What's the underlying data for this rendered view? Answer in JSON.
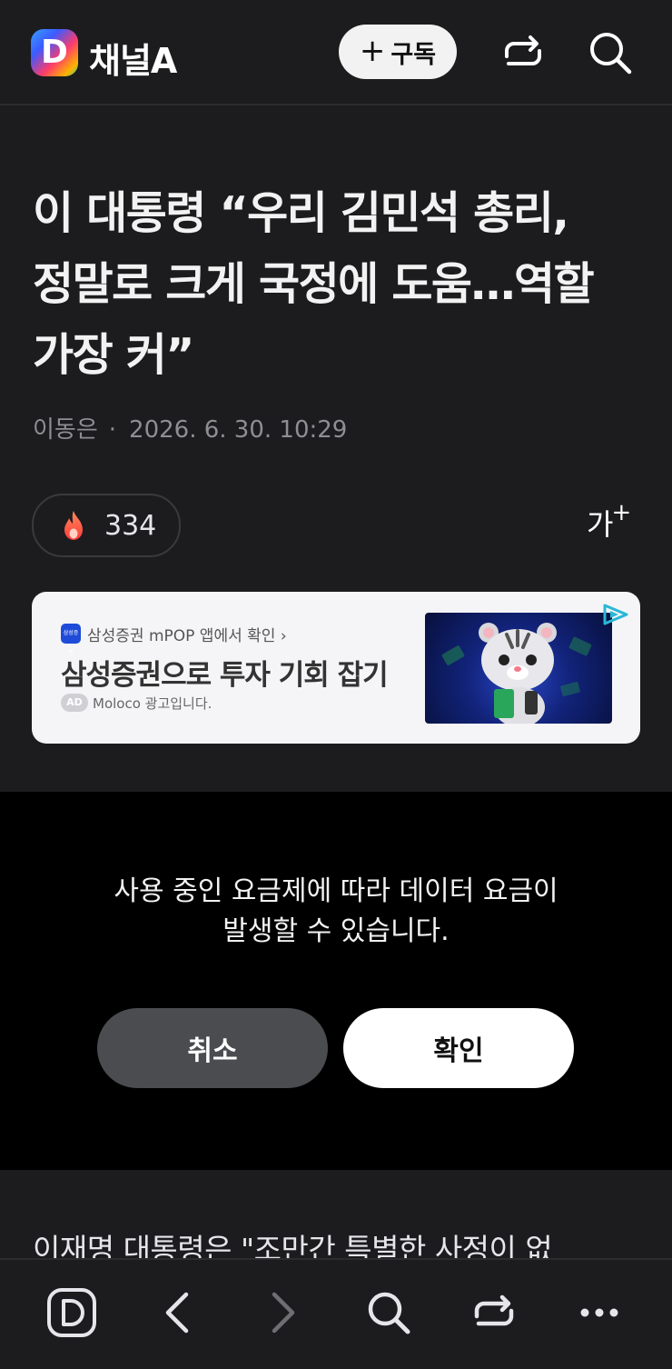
{
  "header": {
    "logo_letter": "D",
    "brand": "채널A",
    "subscribe_plus": "+",
    "subscribe_label": "구독"
  },
  "article": {
    "headline_lines": [
      "이 대통령 “우리 김민석 총리,",
      "정말로 크게 국정에 도움…역할",
      "가장 커”"
    ],
    "author": "이동은",
    "separator": "·",
    "datetime": "2026. 6. 30. 10:29",
    "reaction_count": "334",
    "font_size_label": "가",
    "font_size_plus": "+",
    "body_preview": "이재명 대통령은 \"조만간 특별한 사정이 없"
  },
  "ad": {
    "logo_text": "삼성증권 mPOP",
    "source": "삼성증권 mPOP 앱에서 확인 ›",
    "title": "삼성증권으로 투자 기회 잡기",
    "badge": "AD",
    "note": "Moloco 광고입니다.",
    "choices_color": "#2ab7d6"
  },
  "dialog": {
    "message_line1": "사용 중인 요금제에 따라 데이터 요금이",
    "message_line2": "발생할 수 있습니다.",
    "cancel_label": "취소",
    "confirm_label": "확인"
  },
  "nav": {
    "icons": [
      "home-d-icon",
      "back-arrow-icon",
      "forward-arrow-icon",
      "search-icon",
      "share-icon",
      "more-icon"
    ]
  },
  "colors": {
    "background": "#1c1c1e",
    "overlay": "#000000",
    "cancel_button": "#4a4c50",
    "confirm_button": "#ffffff",
    "flame": "#ff5a3c"
  }
}
